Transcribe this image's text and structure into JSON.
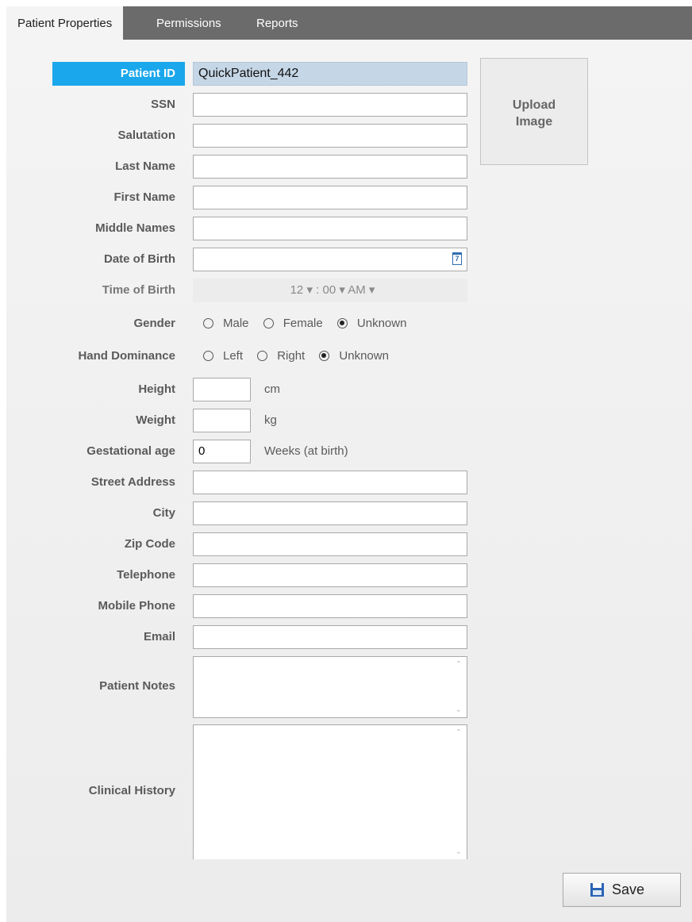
{
  "tabs": [
    "Patient Properties",
    "Permissions",
    "Reports"
  ],
  "labels": {
    "patient_id": "Patient ID",
    "ssn": "SSN",
    "salutation": "Salutation",
    "last_name": "Last Name",
    "first_name": "First Name",
    "middle_names": "Middle Names",
    "dob": "Date of Birth",
    "tob": "Time of Birth",
    "gender": "Gender",
    "hand": "Hand Dominance",
    "height": "Height",
    "weight": "Weight",
    "gest": "Gestational age",
    "street": "Street Address",
    "city": "City",
    "zip": "Zip Code",
    "telephone": "Telephone",
    "mobile": "Mobile Phone",
    "email": "Email",
    "notes": "Patient Notes",
    "history": "Clinical History"
  },
  "values": {
    "patient_id": "QuickPatient_442",
    "time_of_birth": "12  ▾ : 00  ▾ AM  ▾",
    "gestational_age": "0",
    "calendar_day": "7"
  },
  "units": {
    "height": "cm",
    "weight": "kg",
    "gest": "Weeks (at birth)"
  },
  "gender_options": [
    "Male",
    "Female",
    "Unknown"
  ],
  "gender_selected": "Unknown",
  "hand_options": [
    "Left",
    "Right",
    "Unknown"
  ],
  "hand_selected": "Unknown",
  "upload_label": "Upload Image",
  "save_label": "Save",
  "icons": {
    "calendar": "calendar-icon",
    "save": "floppy-disk-icon"
  }
}
